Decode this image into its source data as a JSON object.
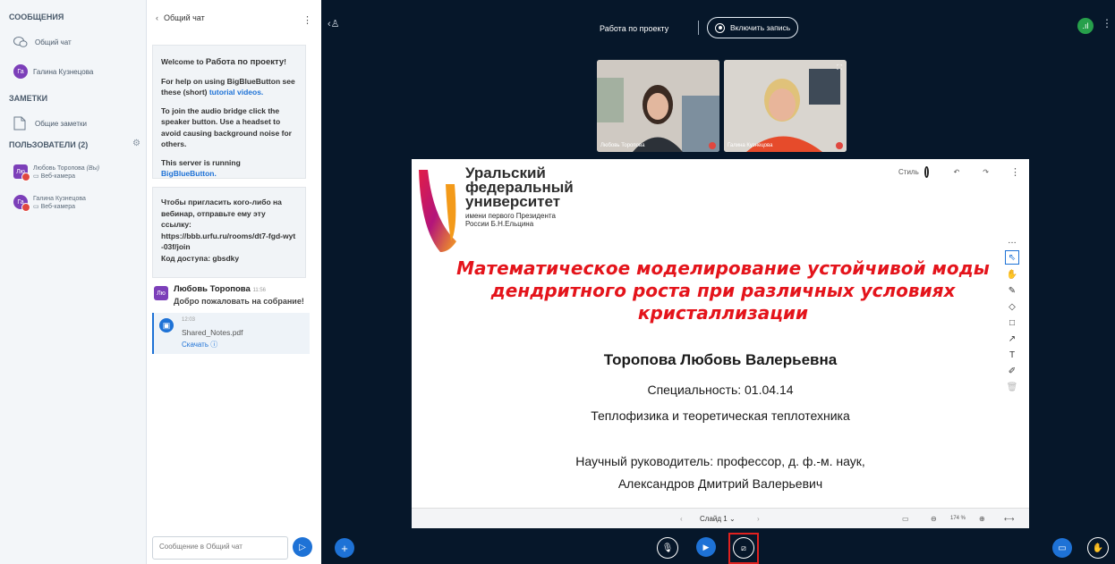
{
  "left_panel": {
    "messages_header": "СООБЩЕНИЯ",
    "public_chat_label": "Общий чат",
    "private_chat_user": "Галина Кузнецова",
    "private_chat_initials": "Га",
    "notes_header": "ЗАМЕТКИ",
    "shared_notes_label": "Общие заметки",
    "users_header": "ПОЛЬЗОВАТЕЛИ (2)",
    "users": [
      {
        "name": "Любовь Торопова",
        "you_tag": "(Вы)",
        "status": "Веб-камера",
        "initials": "Лю",
        "color": "#7c3fb9"
      },
      {
        "name": "Галина Кузнецова",
        "status": "Веб-камера",
        "initials": "Га",
        "color": "#7c3fb9"
      }
    ]
  },
  "chat": {
    "title": "Общий чат",
    "welcome_prefix": "Welcome to ",
    "welcome_name": "Работа по проекту",
    "welcome_suffix": "!",
    "help_text": "For help on using BigBlueButton see these (short) ",
    "help_link": "tutorial videos.",
    "audio_text": "To join the audio bridge click the speaker button. Use a headset to avoid causing background noise for others.",
    "server_text": "This server is running ",
    "server_link": "BigBlueButton.",
    "invite_text": "Чтобы пригласить кого-либо на вебинар, отправьте ему эту ссылку:",
    "invite_link": "https://bbb.urfu.ru/rooms/dt7-fgd-wyt-03f/join",
    "access_code": "Код доступа: gbsdky",
    "msg_author": "Любовь Торопова",
    "msg_initials": "Лю",
    "msg_time": "11:56",
    "msg_text": "Добро пожаловать на собрание!",
    "file_time": "12:03",
    "file_name": "Shared_Notes.pdf",
    "file_download": "Скачать",
    "input_placeholder": "Сообщение в Общий чат"
  },
  "topbar": {
    "meeting_title": "Работа по проекту",
    "record_label": "Включить запись"
  },
  "videos": [
    {
      "name": "Любовь Торопова"
    },
    {
      "name": "Галина Кузнецова"
    }
  ],
  "slide": {
    "logo_line1": "Уральский",
    "logo_line2": "федеральный",
    "logo_line3": "университет",
    "logo_line4": "имени первого Президента",
    "logo_line5": "России Б.Н.Ельцина",
    "title": "Математическое моделирование устойчивой моды дендритного роста при различных условиях кристаллизации",
    "author": "Торопова Любовь Валерьевна",
    "specialty": "Специальность: 01.04.14",
    "field": "Теплофизика и теоретическая теплотехника",
    "advisor_line1": "Научный руководитель: профессор, д. ф.-м. наук,",
    "advisor_line2": "Александров Дмитрий Валерьевич",
    "style_label": "Стиль",
    "slide_select": "Слайд 1",
    "zoom": "174 %"
  },
  "colors": {
    "accent": "#1e72d6",
    "dark_bg": "#06172a",
    "slide_title": "#e4141b",
    "record_highlight": "#e0211f"
  }
}
